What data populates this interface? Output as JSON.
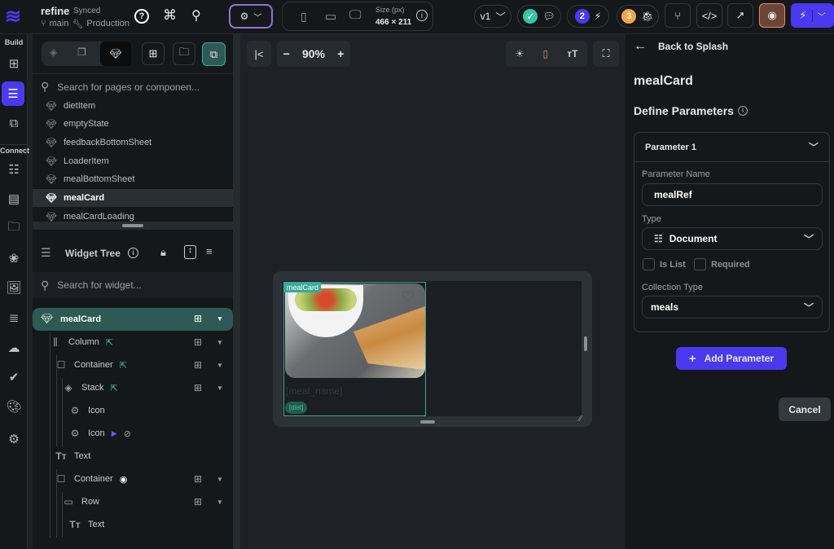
{
  "topbar": {
    "project": "refine",
    "sync_status": "Synced",
    "branch": "main",
    "environment": "Production",
    "size_label": "Size (px)",
    "size_value": "466 × 211",
    "version": "v1",
    "issues_count": "2",
    "bugs_count": "3"
  },
  "rail": {
    "build_label": "Build",
    "connect_label": "Connect"
  },
  "components": {
    "search_placeholder": "Search for pages or componen...",
    "items": [
      {
        "label": "dietItem"
      },
      {
        "label": "emptyState"
      },
      {
        "label": "feedbackBottomSheet"
      },
      {
        "label": "LoaderItem"
      },
      {
        "label": "mealBottomSheet"
      },
      {
        "label": "mealCard",
        "selected": true
      },
      {
        "label": "mealCardLoading"
      }
    ]
  },
  "widget_tree": {
    "title": "Widget Tree",
    "search_placeholder": "Search for widget...",
    "items": [
      {
        "label": "mealCard",
        "icon": "gem-icon"
      },
      {
        "label": "Column",
        "icon": "column-icon"
      },
      {
        "label": "Container",
        "icon": "container-icon"
      },
      {
        "label": "Stack",
        "icon": "stack-icon"
      },
      {
        "label": "Icon",
        "icon": "gear-icon"
      },
      {
        "label": "Icon",
        "icon": "gear-icon"
      },
      {
        "label": "Text",
        "icon": "text-icon"
      },
      {
        "label": "Container",
        "icon": "container-icon"
      },
      {
        "label": "Row",
        "icon": "row-icon"
      },
      {
        "label": "Text",
        "icon": "text-icon"
      }
    ]
  },
  "canvas": {
    "zoom": "90%",
    "component_tag": "mealCard",
    "meal_name": "[meal_name]",
    "diet": "[diet]"
  },
  "right_panel": {
    "back_label": "Back to Splash",
    "component_name": "mealCard",
    "section_title": "Define Parameters",
    "parameter_header": "Parameter 1",
    "param_name_label": "Parameter Name",
    "param_name_value": "mealRef",
    "type_label": "Type",
    "type_value": "Document",
    "is_list_label": "Is List",
    "required_label": "Required",
    "collection_type_label": "Collection Type",
    "collection_type_value": "meals",
    "add_parameter_label": "Add Parameter",
    "cancel_label": "Cancel"
  },
  "colors": {
    "accent": "#4b39ef",
    "teal": "#39a99a",
    "success": "#39c4a8",
    "warning": "#f5a34a",
    "preview": "#6b4538"
  }
}
